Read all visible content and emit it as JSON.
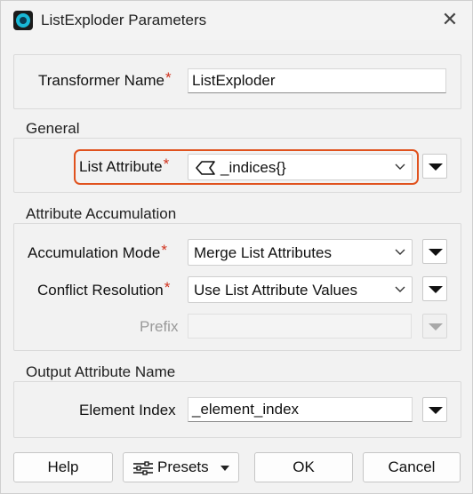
{
  "window": {
    "title": "ListExploder Parameters",
    "close_glyph": "✕",
    "app_icon": "fme-app-icon"
  },
  "transformer": {
    "label": "Transformer Name",
    "required_mark": "*",
    "value": "ListExploder"
  },
  "general": {
    "title": "General",
    "list_attribute": {
      "label": "List Attribute",
      "required_mark": "*",
      "value": "_indices{}",
      "icon": "list-attribute-icon",
      "highlight_color": "#e0521e"
    }
  },
  "accumulation": {
    "title": "Attribute Accumulation",
    "mode": {
      "label": "Accumulation Mode",
      "required_mark": "*",
      "value": "Merge List Attributes"
    },
    "conflict": {
      "label": "Conflict Resolution",
      "required_mark": "*",
      "value": "Use List Attribute Values"
    },
    "prefix": {
      "label": "Prefix",
      "value": ""
    }
  },
  "output": {
    "title": "Output Attribute Name",
    "element_index": {
      "label": "Element Index",
      "value": "_element_index"
    }
  },
  "footer": {
    "help_label": "Help",
    "presets_label": "Presets",
    "ok_label": "OK",
    "cancel_label": "Cancel"
  }
}
